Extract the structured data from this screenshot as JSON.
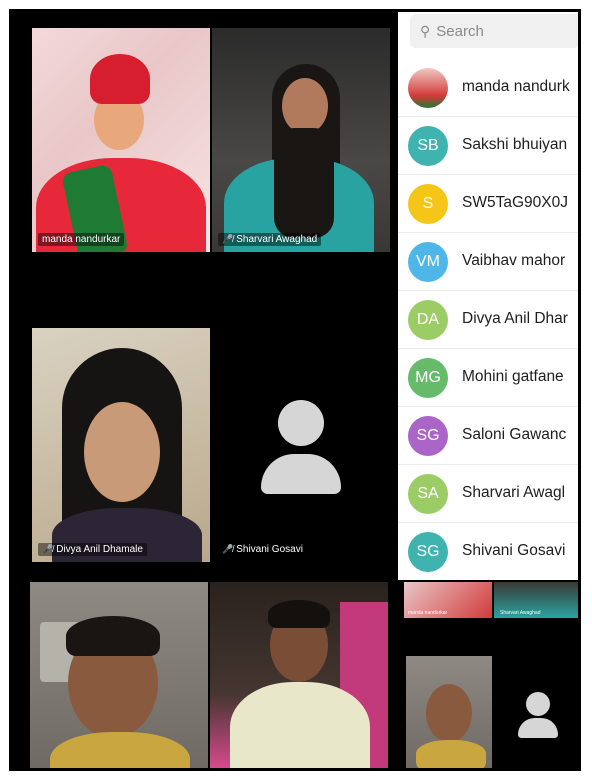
{
  "search": {
    "placeholder": "Search"
  },
  "gallery": {
    "tiles": [
      {
        "name": "manda nandurkar",
        "muted": false
      },
      {
        "name": "Sharvari Awaghad",
        "muted": true
      },
      {
        "name": "Divya Anil Dhamale",
        "muted": true
      },
      {
        "name": "Shivani Gosavi",
        "muted": true,
        "video_off": true
      }
    ]
  },
  "participants": [
    {
      "name": "manda nandurk",
      "initials": "",
      "color": "#c0392b",
      "photo": true
    },
    {
      "name": "Sakshi bhuiyan",
      "initials": "SB",
      "color": "#3fb3b0"
    },
    {
      "name": "SW5TaG90X0J",
      "initials": "S",
      "color": "#f5c518"
    },
    {
      "name": "Vaibhav mahor",
      "initials": "VM",
      "color": "#4fb7e8"
    },
    {
      "name": "Divya Anil Dhar",
      "initials": "DA",
      "color": "#9ccc65"
    },
    {
      "name": "Mohini gatfane",
      "initials": "MG",
      "color": "#66bb6a"
    },
    {
      "name": "Saloni Gawanc",
      "initials": "SG",
      "color": "#ab64c8"
    },
    {
      "name": "Sharvari Awagl",
      "initials": "SA",
      "color": "#9ccc65"
    },
    {
      "name": "Shivani Gosavi",
      "initials": "SG",
      "color": "#3fb3b0"
    }
  ],
  "mini_gallery": {
    "names": [
      "manda nandurkar",
      "Sharvari Awaghad"
    ]
  },
  "icons": {
    "muted": "mic-off-icon",
    "search": "search-icon",
    "avatar": "person-placeholder-icon"
  }
}
